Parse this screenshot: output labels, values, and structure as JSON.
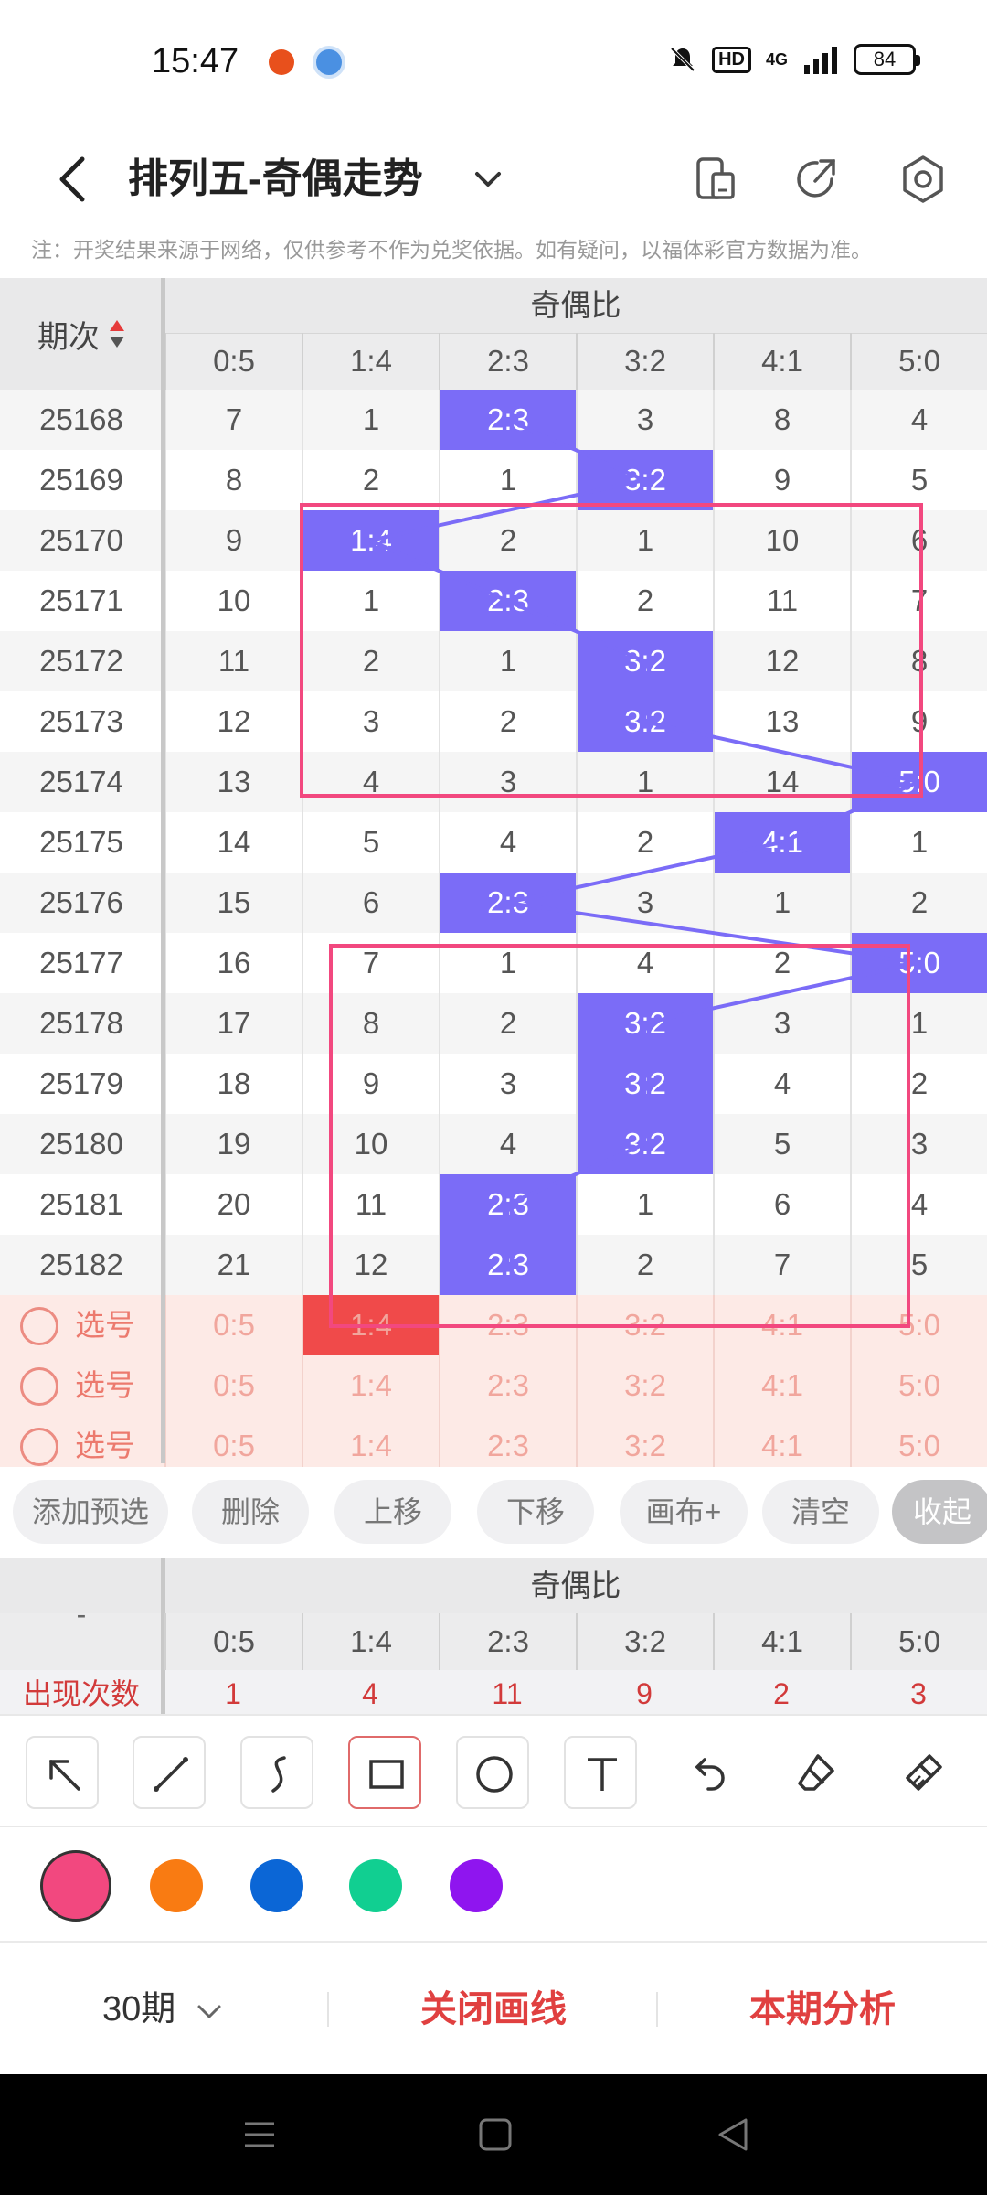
{
  "status": {
    "time": "15:47",
    "network": "4G",
    "hd": "HD",
    "battery": "84"
  },
  "header": {
    "title": "排列五-奇偶走势"
  },
  "notice": "注：开奖结果来源于网络，仅供参考不作为兑奖依据。如有疑问，以福体彩官方数据为准。",
  "table": {
    "issue_header": "期次",
    "group_title": "奇偶比",
    "columns": [
      "0:5",
      "1:4",
      "2:3",
      "3:2",
      "4:1",
      "5:0"
    ],
    "rows": [
      {
        "issue": "25168",
        "cells": [
          "7",
          "1",
          "2:3",
          "3",
          "8",
          "4"
        ],
        "hit": 2
      },
      {
        "issue": "25169",
        "cells": [
          "8",
          "2",
          "1",
          "3:2",
          "9",
          "5"
        ],
        "hit": 3
      },
      {
        "issue": "25170",
        "cells": [
          "9",
          "1:4",
          "2",
          "1",
          "10",
          "6"
        ],
        "hit": 1
      },
      {
        "issue": "25171",
        "cells": [
          "10",
          "1",
          "2:3",
          "2",
          "11",
          "7"
        ],
        "hit": 2
      },
      {
        "issue": "25172",
        "cells": [
          "11",
          "2",
          "1",
          "3:2",
          "12",
          "8"
        ],
        "hit": 3
      },
      {
        "issue": "25173",
        "cells": [
          "12",
          "3",
          "2",
          "3:2",
          "13",
          "9"
        ],
        "hit": 3
      },
      {
        "issue": "25174",
        "cells": [
          "13",
          "4",
          "3",
          "1",
          "14",
          "5:0"
        ],
        "hit": 5
      },
      {
        "issue": "25175",
        "cells": [
          "14",
          "5",
          "4",
          "2",
          "4:1",
          "1"
        ],
        "hit": 4
      },
      {
        "issue": "25176",
        "cells": [
          "15",
          "6",
          "2:3",
          "3",
          "1",
          "2"
        ],
        "hit": 2
      },
      {
        "issue": "25177",
        "cells": [
          "16",
          "7",
          "1",
          "4",
          "2",
          "5:0"
        ],
        "hit": 5
      },
      {
        "issue": "25178",
        "cells": [
          "17",
          "8",
          "2",
          "3:2",
          "3",
          "1"
        ],
        "hit": 3
      },
      {
        "issue": "25179",
        "cells": [
          "18",
          "9",
          "3",
          "3:2",
          "4",
          "2"
        ],
        "hit": 3
      },
      {
        "issue": "25180",
        "cells": [
          "19",
          "10",
          "4",
          "3:2",
          "5",
          "3"
        ],
        "hit": 3
      },
      {
        "issue": "25181",
        "cells": [
          "20",
          "11",
          "2:3",
          "1",
          "6",
          "4"
        ],
        "hit": 2
      },
      {
        "issue": "25182",
        "cells": [
          "21",
          "12",
          "2:3",
          "2",
          "7",
          "5"
        ],
        "hit": 2
      }
    ],
    "select_label": "选号",
    "select_rows": [
      {
        "cells": [
          "0:5",
          "1:4",
          "2:3",
          "3:2",
          "4:1",
          "5:0"
        ],
        "picked": 1
      },
      {
        "cells": [
          "0:5",
          "1:4",
          "2:3",
          "3:2",
          "4:1",
          "5:0"
        ],
        "picked": -1
      },
      {
        "cells": [
          "0:5",
          "1:4",
          "2:3",
          "3:2",
          "4:1",
          "5:0"
        ],
        "picked": -1
      }
    ]
  },
  "actions": [
    "添加预选",
    "删除",
    "上移",
    "下移",
    "画布+",
    "清空",
    "收起"
  ],
  "stats": {
    "dash": "-",
    "group_title": "奇偶比",
    "columns": [
      "0:5",
      "1:4",
      "2:3",
      "3:2",
      "4:1",
      "5:0"
    ],
    "label": "出现次数",
    "values": [
      "1",
      "4",
      "11",
      "9",
      "2",
      "3"
    ]
  },
  "tools": [
    "arrow-tool",
    "line-tool",
    "curve-tool",
    "rectangle-tool",
    "circle-tool",
    "text-tool",
    "undo-tool",
    "eraser-tool",
    "clear-brush-tool"
  ],
  "colors": [
    "#f2487f",
    "#f97b12",
    "#0b66d6",
    "#11cf91",
    "#8f15ef"
  ],
  "bottom": {
    "period": "30期",
    "close_draw": "关闭画线",
    "analysis": "本期分析"
  },
  "icon_names": {
    "back": "back-icon",
    "dropdown": "chevron-down-icon",
    "phone": "phone-icon",
    "share": "share-icon",
    "settings": "settings-icon"
  }
}
